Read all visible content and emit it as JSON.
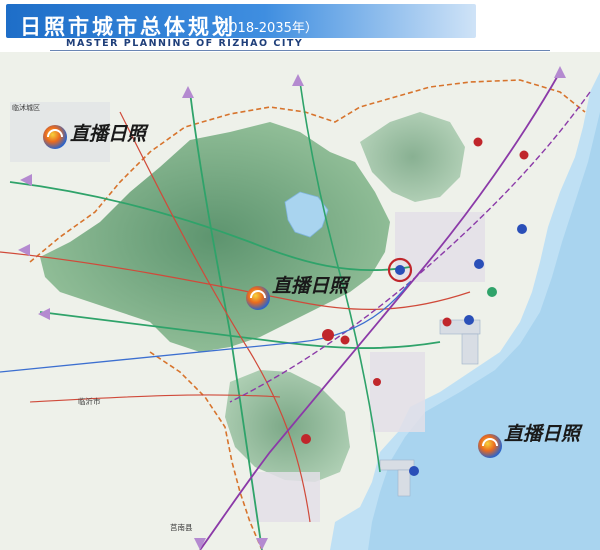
{
  "header": {
    "title": "日照市城市总体规划",
    "years": "（2018-2035年）",
    "subtitle": "MASTER PLANNING OF RIZHAO CITY"
  },
  "map": {
    "place_labels": {
      "linyi": "临沂市",
      "jvnan": "莒南县",
      "linshu": "临沭城区"
    },
    "colors": {
      "sea": "#bfe0f4",
      "land": "#eef1ea",
      "mountain": "#5f9a72",
      "railway": "#8b3aa8",
      "expressway": "#2fa36a",
      "highway": "#d04a3a",
      "boundary": "#d7742d"
    }
  },
  "watermarks": [
    {
      "text": "直播日照"
    },
    {
      "text": "直播日照"
    },
    {
      "text": "直播日照"
    }
  ]
}
